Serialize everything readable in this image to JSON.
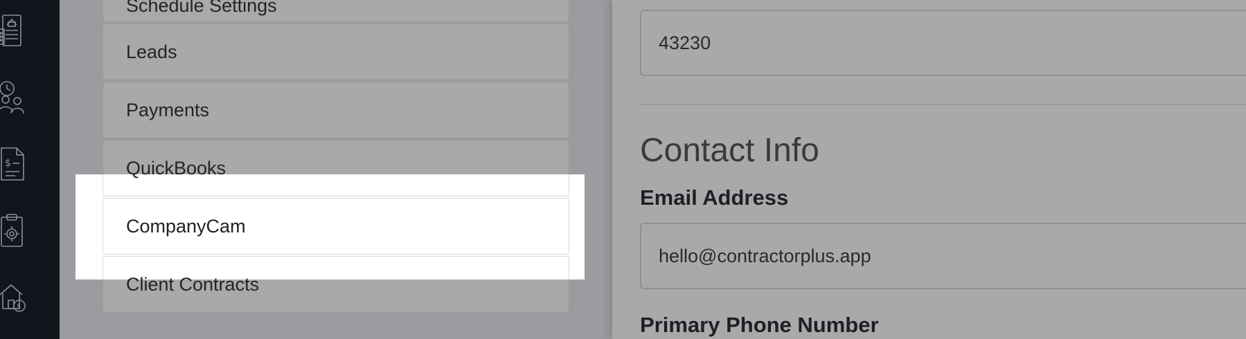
{
  "sidebar_icons": [
    {
      "name": "building-calculator-icon"
    },
    {
      "name": "clock-team-icon"
    },
    {
      "name": "invoice-dollar-icon"
    },
    {
      "name": "clipboard-gear-icon"
    },
    {
      "name": "house-money-icon"
    }
  ],
  "settings_menu": {
    "items": [
      {
        "label": "Schedule Settings"
      },
      {
        "label": "Leads"
      },
      {
        "label": "Payments"
      },
      {
        "label": "QuickBooks"
      },
      {
        "label": "CompanyCam"
      },
      {
        "label": "Client Contracts"
      }
    ],
    "highlighted": "CompanyCam"
  },
  "form": {
    "zip_value": "43230",
    "section_title": "Contact Info",
    "email_label": "Email Address",
    "email_value": "hello@contractorplus.app",
    "phone_label": "Primary Phone Number"
  },
  "colors": {
    "rail_bg": "#12151b",
    "overlay_dim": "#a9a9a9",
    "highlight": "#ffffff"
  }
}
